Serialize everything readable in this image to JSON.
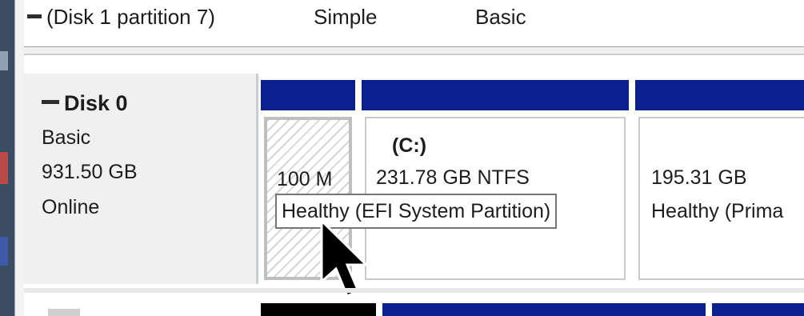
{
  "volume_row": {
    "layout_name": "(Disk 1 partition 7)",
    "type": "Simple",
    "fs_type": "Basic"
  },
  "disk0": {
    "name": "Disk 0",
    "kind": "Basic",
    "size": "931.50 GB",
    "status": "Online"
  },
  "partitions": [
    {
      "size_label": "100 M",
      "name": "",
      "status": ""
    },
    {
      "name": "(C:)",
      "size_label": "231.78 GB NTFS",
      "status": "Healthy (EFI System Partition)"
    },
    {
      "name": "",
      "size_label": "195.31 GB",
      "status": "Healthy (Prima"
    }
  ],
  "tooltip": {
    "text": "Healthy (EFI System Partition)"
  },
  "colors": {
    "primary_partition_bar": "#0b1f8f",
    "unallocated_bar": "#000000",
    "background": "#3b4d63"
  }
}
